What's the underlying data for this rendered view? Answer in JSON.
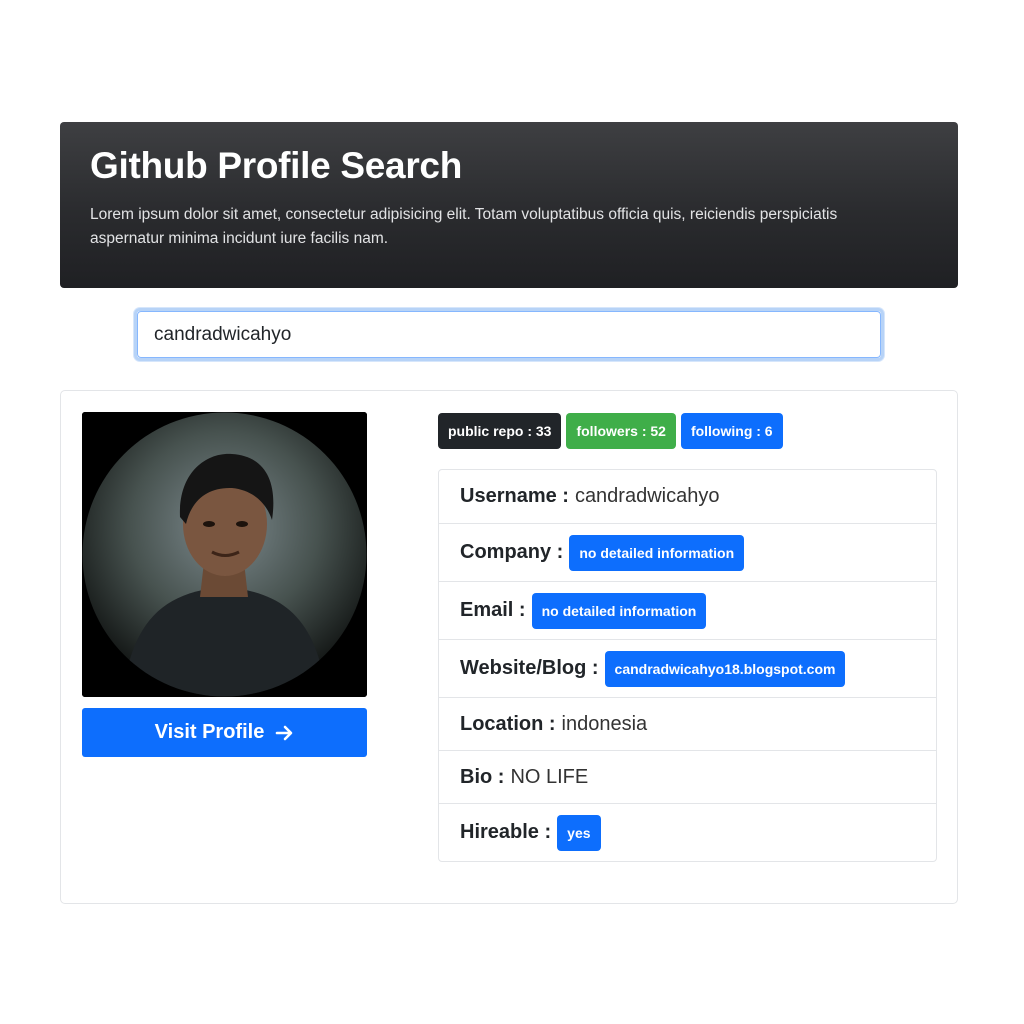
{
  "header": {
    "title": "Github Profile Search",
    "description": "Lorem ipsum dolor sit amet, consectetur adipisicing elit. Totam voluptatibus officia quis, reiciendis perspiciatis aspernatur minima incidunt iure facilis nam."
  },
  "search": {
    "value": "candradwicahyo"
  },
  "profile": {
    "visit_label": "Visit Profile",
    "stats": {
      "public_repo": "public repo : 33",
      "followers": "followers : 52",
      "following": "following : 6"
    },
    "fields": {
      "username_key": "Username :",
      "username_val": "candradwicahyo",
      "company_key": "Company :",
      "company_val": "no detailed information",
      "email_key": "Email :",
      "email_val": "no detailed information",
      "website_key": "Website/Blog :",
      "website_val": "candradwicahyo18.blogspot.com",
      "location_key": "Location :",
      "location_val": "indonesia",
      "bio_key": "Bio :",
      "bio_val": "NO LIFE",
      "hireable_key": "Hireable :",
      "hireable_val": "yes"
    }
  },
  "colors": {
    "primary": "#0d6efd",
    "success": "#3fae49",
    "dark": "#212529"
  },
  "icons": {
    "visit": "arrow-right-icon"
  }
}
